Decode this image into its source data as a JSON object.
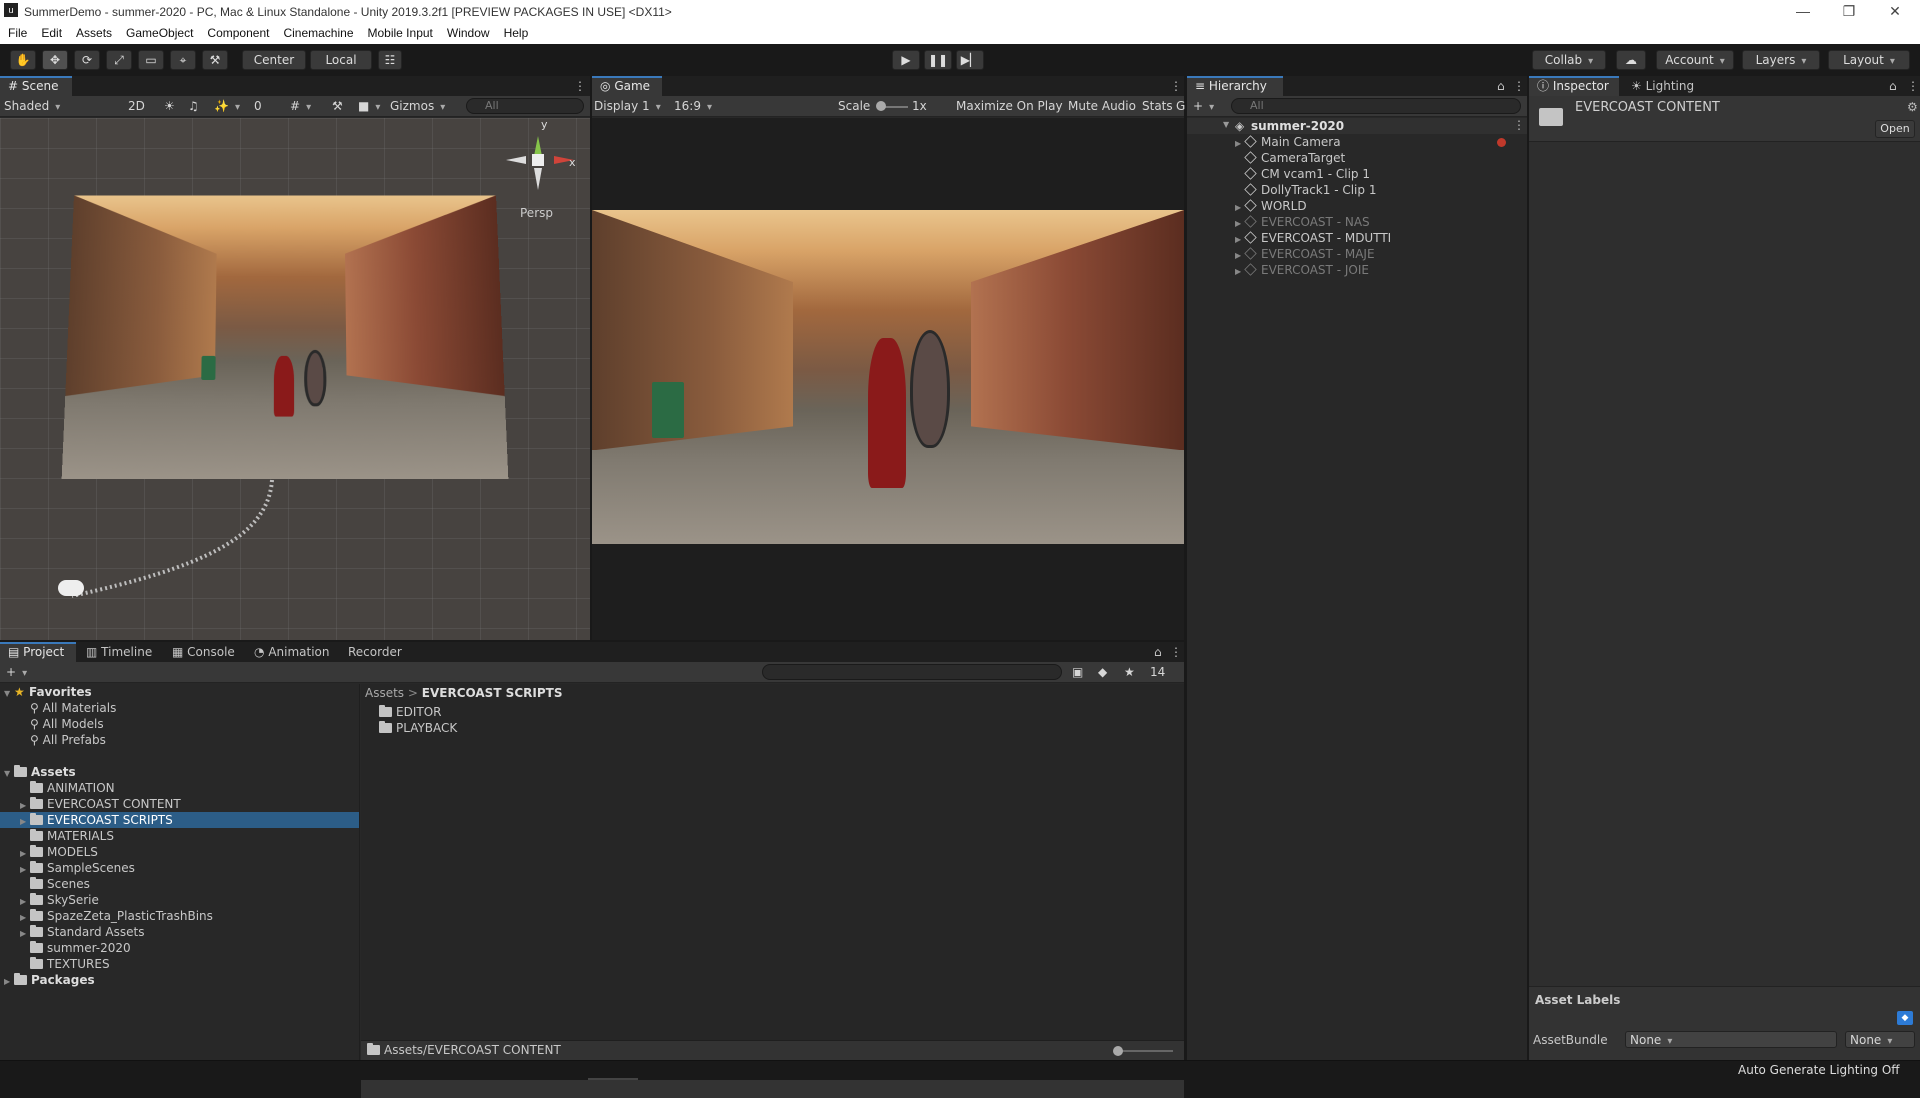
{
  "window": {
    "title": "SummerDemo - summer-2020 - PC, Mac & Linux Standalone - Unity 2019.3.2f1 [PREVIEW PACKAGES IN USE] <DX11>",
    "logo": "u",
    "minimize": "—",
    "restore": "❐",
    "close": "✕"
  },
  "menu": [
    "File",
    "Edit",
    "Assets",
    "GameObject",
    "Component",
    "Cinemachine",
    "Mobile Input",
    "Window",
    "Help"
  ],
  "toolbar": {
    "hand": "✋",
    "move": "✥",
    "rotate": "⟳",
    "scale": "⤢",
    "rect": "▭",
    "transform": "⌖",
    "custom": "⚒",
    "pivot": "Center",
    "space": "Local",
    "snap": "☷",
    "play": "▶",
    "pause": "❚❚",
    "step": "▶▏",
    "collab": "Collab",
    "cloud": "☁",
    "account": "Account",
    "layers": "Layers",
    "layout": "Layout"
  },
  "scene": {
    "tab": "Scene",
    "tab_icon": "#",
    "shading": "Shaded",
    "mode2d": "2D",
    "light": "☀",
    "audio": "♫",
    "fx": "✨",
    "hidden": "0",
    "grid": "#",
    "tool": "⚒",
    "camera": "■",
    "gizmos": "Gizmos",
    "search_placeholder": "All",
    "persp": "Persp",
    "axis_x": "x",
    "axis_y": "y",
    "menu": "⋮",
    "camera_icon": "▣"
  },
  "game": {
    "tab": "Game",
    "tab_icon": "◎",
    "display": "Display 1",
    "aspect": "16:9",
    "scale_label": "Scale",
    "scale_value": "1x",
    "maximize": "Maximize On Play",
    "mute": "Mute Audio",
    "stats": "Stats",
    "gizmos": "G",
    "menu": "⋮"
  },
  "hierarchy": {
    "tab": "Hierarchy",
    "tab_icon": "≡",
    "search_placeholder": "All",
    "add": "+",
    "root": "summer-2020",
    "lock": "⌂",
    "menu": "⋮",
    "items": [
      {
        "label": "Main Camera",
        "arrow": "▶",
        "dim": false
      },
      {
        "label": "CameraTarget",
        "arrow": "",
        "dim": false
      },
      {
        "label": "CM vcam1 - Clip 1",
        "arrow": "",
        "dim": false
      },
      {
        "label": "DollyTrack1 - Clip 1",
        "arrow": "",
        "dim": false
      },
      {
        "label": "WORLD",
        "arrow": "▶",
        "dim": false
      },
      {
        "label": "EVERCOAST - NAS",
        "arrow": "▶",
        "dim": true
      },
      {
        "label": "EVERCOAST - MDUTTI",
        "arrow": "▶",
        "dim": false
      },
      {
        "label": "EVERCOAST - MAJE",
        "arrow": "▶",
        "dim": true
      },
      {
        "label": "EVERCOAST - JOIE",
        "arrow": "▶",
        "dim": true
      }
    ]
  },
  "inspector": {
    "tab": "Inspector",
    "tab_icon": "ⓘ",
    "lighting_tab": "Lighting",
    "lighting_icon": "☀",
    "title": "EVERCOAST CONTENT",
    "open_button": "Open",
    "gear": "⚙",
    "asset_labels": "Asset Labels",
    "tag": "◆",
    "assetbundle_label": "AssetBundle",
    "bundle_value": "None",
    "variant_value": "None",
    "lock": "⌂",
    "menu": "⋮"
  },
  "bottom_tabs": {
    "project": "Project",
    "project_icon": "▤",
    "timeline": "Timeline",
    "timeline_icon": "▥",
    "console": "Console",
    "console_icon": "▦",
    "animation": "Animation",
    "animation_icon": "◔",
    "recorder": "Recorder",
    "lock": "⌂",
    "menu": "⋮"
  },
  "project": {
    "add": "+",
    "search_placeholder": "",
    "filter_type": "▣",
    "filter_label": "◆",
    "star": "★",
    "hidden_count": "14",
    "favorites": {
      "label": "Favorites",
      "star": "★",
      "items": [
        "All Materials",
        "All Models",
        "All Prefabs"
      ]
    },
    "assets": {
      "label": "Assets",
      "items": [
        {
          "label": "ANIMATION",
          "arrow": ""
        },
        {
          "label": "EVERCOAST CONTENT",
          "arrow": "▶"
        },
        {
          "label": "EVERCOAST SCRIPTS",
          "arrow": "▶",
          "selected": true
        },
        {
          "label": "MATERIALS",
          "arrow": ""
        },
        {
          "label": "MODELS",
          "arrow": "▶"
        },
        {
          "label": "SampleScenes",
          "arrow": "▶"
        },
        {
          "label": "Scenes",
          "arrow": ""
        },
        {
          "label": "SkySerie",
          "arrow": "▶"
        },
        {
          "label": "SpazeZeta_PlasticTrashBins",
          "arrow": "▶"
        },
        {
          "label": "Standard Assets",
          "arrow": "▶"
        },
        {
          "label": "summer-2020",
          "arrow": ""
        },
        {
          "label": "TEXTURES",
          "arrow": ""
        }
      ]
    },
    "packages": "Packages",
    "breadcrumb_root": "Assets",
    "breadcrumb_sep": ">",
    "breadcrumb_current": "EVERCOAST SCRIPTS",
    "contents": [
      "EDITOR",
      "PLAYBACK"
    ],
    "status_path": "Assets/EVERCOAST CONTENT"
  },
  "statusbar": {
    "text": "Auto Generate Lighting Off"
  }
}
